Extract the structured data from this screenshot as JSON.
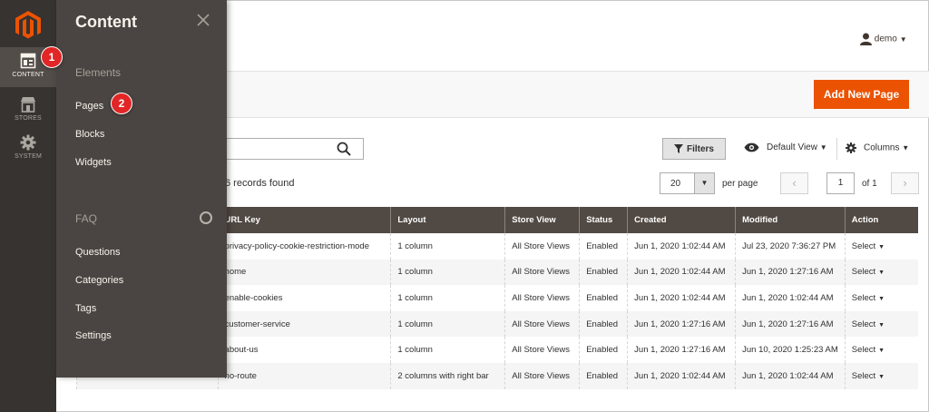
{
  "nav": {
    "items": [
      {
        "label": "CONTENT"
      },
      {
        "label": "STORES"
      },
      {
        "label": "SYSTEM"
      }
    ]
  },
  "flyout": {
    "title": "Content",
    "sections": [
      {
        "title": "Elements",
        "items": [
          "Pages",
          "Blocks",
          "Widgets"
        ]
      },
      {
        "title": "FAQ",
        "items": [
          "Questions",
          "Categories",
          "Tags",
          "Settings"
        ]
      }
    ]
  },
  "callouts": [
    "1",
    "2"
  ],
  "header": {
    "user": "demo"
  },
  "actions": {
    "add_new_page": "Add New Page"
  },
  "toolbar": {
    "filters": "Filters",
    "view": "Default View",
    "columns": "Columns",
    "records": "6 records found",
    "per_page_value": "20",
    "per_page_label": "per page",
    "page_value": "1",
    "page_of": "of 1"
  },
  "table": {
    "headers": [
      "URL Key",
      "Layout",
      "Store View",
      "Status",
      "Created",
      "Modified",
      "Action"
    ],
    "rows": [
      [
        "privacy-policy-cookie-restriction-mode",
        "1 column",
        "All Store Views",
        "Enabled",
        "Jun 1, 2020 1:02:44 AM",
        "Jul 23, 2020 7:36:27 PM",
        "Select"
      ],
      [
        "home",
        "1 column",
        "All Store Views",
        "Enabled",
        "Jun 1, 2020 1:02:44 AM",
        "Jun 1, 2020 1:27:16 AM",
        "Select"
      ],
      [
        "enable-cookies",
        "1 column",
        "All Store Views",
        "Enabled",
        "Jun 1, 2020 1:02:44 AM",
        "Jun 1, 2020 1:02:44 AM",
        "Select"
      ],
      [
        "customer-service",
        "1 column",
        "All Store Views",
        "Enabled",
        "Jun 1, 2020 1:27:16 AM",
        "Jun 1, 2020 1:27:16 AM",
        "Select"
      ],
      [
        "about-us",
        "1 column",
        "All Store Views",
        "Enabled",
        "Jun 1, 2020 1:27:16 AM",
        "Jun 10, 2020 1:25:23 AM",
        "Select"
      ],
      [
        "no-route",
        "2 columns with right bar",
        "All Store Views",
        "Enabled",
        "Jun 1, 2020 1:02:44 AM",
        "Jun 1, 2020 1:02:44 AM",
        "Select"
      ]
    ]
  },
  "colors": {
    "accent": "#eb5202",
    "nav_bg": "#373330",
    "flyout_bg": "#4a4542",
    "header_bg": "#514943",
    "link": "#1979c3",
    "callout": "#e22626"
  }
}
